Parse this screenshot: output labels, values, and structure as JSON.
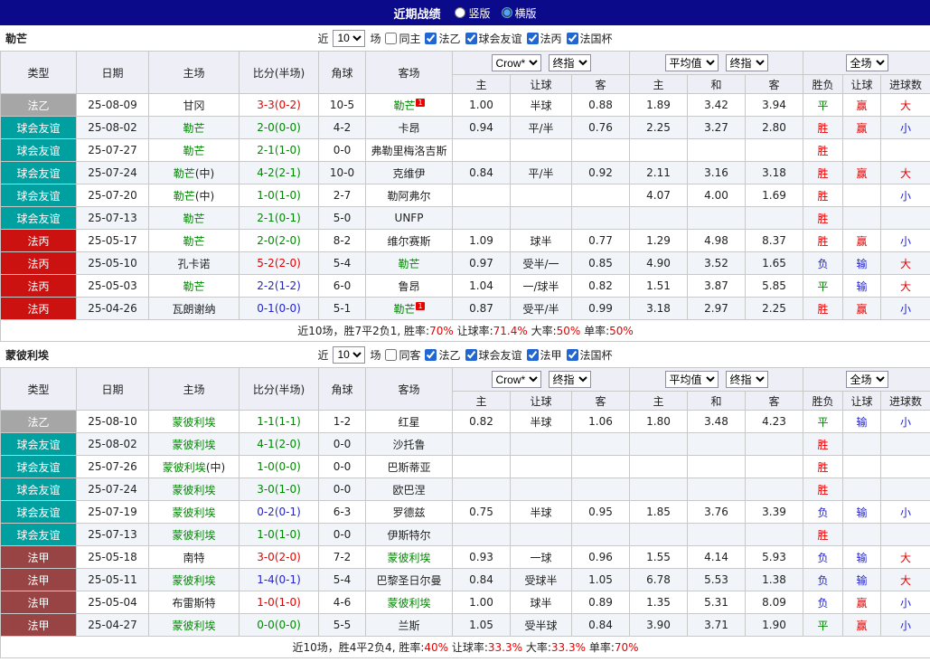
{
  "palette": {
    "black": "#222222",
    "green": "#008800",
    "red": "#e60000",
    "blue": "#2323cc",
    "badge_gray": "#a6a6a6",
    "badge_teal": "#00a0a0",
    "badge_red": "#cc1111",
    "badge_maroon": "#994444",
    "navy": "#0a0a8a"
  },
  "topbar": {
    "title": "近期战绩",
    "options": [
      {
        "label": "竖版",
        "selected": false
      },
      {
        "label": "横版",
        "selected": true
      }
    ]
  },
  "table_header": {
    "cols": [
      "类型",
      "日期",
      "主场",
      "比分(半场)",
      "角球",
      "客场"
    ],
    "group_selects": [
      [
        "Crow*",
        "终指"
      ],
      [
        "平均值",
        "终指"
      ],
      [
        "全场"
      ]
    ],
    "sub": [
      "主",
      "让球",
      "客",
      "主",
      "和",
      "客",
      "胜负",
      "让球",
      "进球数"
    ]
  },
  "sections": [
    {
      "team": "勒芒",
      "filter": {
        "near_label": "近",
        "count": "10",
        "games_label": "场",
        "same_label": "同主",
        "same_checked": false,
        "leagues": [
          "法乙",
          "球会友谊",
          "法丙",
          "法国杯"
        ]
      },
      "rows": [
        {
          "league": "法乙",
          "lc": "badge_gray",
          "date": "25-08-09",
          "home": {
            "t": "甘冈",
            "c": "black"
          },
          "score": {
            "t": "3-3(0-2)",
            "c": "red"
          },
          "corner": "10-5",
          "away": {
            "t": "勒芒",
            "c": "green",
            "sup": "1"
          },
          "odds": [
            "1.00",
            "半球",
            "0.88",
            "1.89",
            "3.42",
            "3.94"
          ],
          "res": [
            [
              "平",
              "green"
            ],
            [
              "赢",
              "red"
            ],
            [
              "大",
              "red"
            ]
          ]
        },
        {
          "league": "球会友谊",
          "lc": "badge_teal",
          "date": "25-08-02",
          "home": {
            "t": "勒芒",
            "c": "green"
          },
          "score": {
            "t": "2-0(0-0)",
            "c": "green"
          },
          "corner": "4-2",
          "away": {
            "t": "卡昂",
            "c": "black"
          },
          "odds": [
            "0.94",
            "平/半",
            "0.76",
            "2.25",
            "3.27",
            "2.80"
          ],
          "res": [
            [
              "胜",
              "red"
            ],
            [
              "赢",
              "red"
            ],
            [
              "小",
              "blue"
            ]
          ]
        },
        {
          "league": "球会友谊",
          "lc": "badge_teal",
          "date": "25-07-27",
          "home": {
            "t": "勒芒",
            "c": "green"
          },
          "score": {
            "t": "2-1(1-0)",
            "c": "green"
          },
          "corner": "0-0",
          "away": {
            "t": "弗勒里梅洛吉斯",
            "c": "black"
          },
          "odds": [
            "",
            "",
            "",
            "",
            "",
            ""
          ],
          "res": [
            [
              "胜",
              "red"
            ],
            [
              "",
              ""
            ],
            [
              "",
              ""
            ]
          ]
        },
        {
          "league": "球会友谊",
          "lc": "badge_teal",
          "date": "25-07-24",
          "home": {
            "t": "勒芒",
            "c": "green",
            "suf": "(中)"
          },
          "score": {
            "t": "4-2(2-1)",
            "c": "green"
          },
          "corner": "10-0",
          "away": {
            "t": "克维伊",
            "c": "black"
          },
          "odds": [
            "0.84",
            "平/半",
            "0.92",
            "2.11",
            "3.16",
            "3.18"
          ],
          "res": [
            [
              "胜",
              "red"
            ],
            [
              "赢",
              "red"
            ],
            [
              "大",
              "red"
            ]
          ]
        },
        {
          "league": "球会友谊",
          "lc": "badge_teal",
          "date": "25-07-20",
          "home": {
            "t": "勒芒",
            "c": "green",
            "suf": "(中)"
          },
          "score": {
            "t": "1-0(1-0)",
            "c": "green"
          },
          "corner": "2-7",
          "away": {
            "t": "勒阿弗尔",
            "c": "black"
          },
          "odds": [
            "",
            "",
            "",
            "4.07",
            "4.00",
            "1.69"
          ],
          "res": [
            [
              "胜",
              "red"
            ],
            [
              "",
              ""
            ],
            [
              "小",
              "blue"
            ]
          ]
        },
        {
          "league": "球会友谊",
          "lc": "badge_teal",
          "date": "25-07-13",
          "home": {
            "t": "勒芒",
            "c": "green"
          },
          "score": {
            "t": "2-1(0-1)",
            "c": "green"
          },
          "corner": "5-0",
          "away": {
            "t": "UNFP",
            "c": "black"
          },
          "odds": [
            "",
            "",
            "",
            "",
            "",
            ""
          ],
          "res": [
            [
              "胜",
              "red"
            ],
            [
              "",
              ""
            ],
            [
              "",
              ""
            ]
          ]
        },
        {
          "league": "法丙",
          "lc": "badge_red",
          "date": "25-05-17",
          "home": {
            "t": "勒芒",
            "c": "green"
          },
          "score": {
            "t": "2-0(2-0)",
            "c": "green"
          },
          "corner": "8-2",
          "away": {
            "t": "维尔赛斯",
            "c": "black"
          },
          "odds": [
            "1.09",
            "球半",
            "0.77",
            "1.29",
            "4.98",
            "8.37"
          ],
          "res": [
            [
              "胜",
              "red"
            ],
            [
              "赢",
              "red"
            ],
            [
              "小",
              "blue"
            ]
          ]
        },
        {
          "league": "法丙",
          "lc": "badge_red",
          "date": "25-05-10",
          "home": {
            "t": "孔卡诺",
            "c": "black"
          },
          "score": {
            "t": "5-2(2-0)",
            "c": "red"
          },
          "corner": "5-4",
          "away": {
            "t": "勒芒",
            "c": "green"
          },
          "odds": [
            "0.97",
            "受半/一",
            "0.85",
            "4.90",
            "3.52",
            "1.65"
          ],
          "res": [
            [
              "负",
              "blue"
            ],
            [
              "输",
              "blue"
            ],
            [
              "大",
              "red"
            ]
          ]
        },
        {
          "league": "法丙",
          "lc": "badge_red",
          "date": "25-05-03",
          "home": {
            "t": "勒芒",
            "c": "green"
          },
          "score": {
            "t": "2-2(1-2)",
            "c": "blue"
          },
          "corner": "6-0",
          "away": {
            "t": "鲁昂",
            "c": "black"
          },
          "odds": [
            "1.04",
            "一/球半",
            "0.82",
            "1.51",
            "3.87",
            "5.85"
          ],
          "res": [
            [
              "平",
              "green"
            ],
            [
              "输",
              "blue"
            ],
            [
              "大",
              "red"
            ]
          ]
        },
        {
          "league": "法丙",
          "lc": "badge_red",
          "date": "25-04-26",
          "home": {
            "t": "瓦朗谢纳",
            "c": "black"
          },
          "score": {
            "t": "0-1(0-0)",
            "c": "blue"
          },
          "corner": "5-1",
          "away": {
            "t": "勒芒",
            "c": "green",
            "sup": "1"
          },
          "odds": [
            "0.87",
            "受平/半",
            "0.99",
            "3.18",
            "2.97",
            "2.25"
          ],
          "res": [
            [
              "胜",
              "red"
            ],
            [
              "赢",
              "red"
            ],
            [
              "小",
              "blue"
            ]
          ]
        }
      ],
      "summary": [
        [
          "近10场，胜7平2负1, 胜率:",
          "black"
        ],
        [
          "70%",
          "red"
        ],
        [
          " 让球率:",
          "black"
        ],
        [
          "71.4%",
          "red"
        ],
        [
          " 大率:",
          "black"
        ],
        [
          "50%",
          "red"
        ],
        [
          " 单率:",
          "black"
        ],
        [
          "50%",
          "red"
        ]
      ]
    },
    {
      "team": "蒙彼利埃",
      "filter": {
        "near_label": "近",
        "count": "10",
        "games_label": "场",
        "same_label": "同客",
        "same_checked": false,
        "leagues": [
          "法乙",
          "球会友谊",
          "法甲",
          "法国杯"
        ]
      },
      "rows": [
        {
          "league": "法乙",
          "lc": "badge_gray",
          "date": "25-08-10",
          "home": {
            "t": "蒙彼利埃",
            "c": "green"
          },
          "score": {
            "t": "1-1(1-1)",
            "c": "green"
          },
          "corner": "1-2",
          "away": {
            "t": "红星",
            "c": "black"
          },
          "odds": [
            "0.82",
            "半球",
            "1.06",
            "1.80",
            "3.48",
            "4.23"
          ],
          "res": [
            [
              "平",
              "green"
            ],
            [
              "输",
              "blue"
            ],
            [
              "小",
              "blue"
            ]
          ]
        },
        {
          "league": "球会友谊",
          "lc": "badge_teal",
          "date": "25-08-02",
          "home": {
            "t": "蒙彼利埃",
            "c": "green"
          },
          "score": {
            "t": "4-1(2-0)",
            "c": "green"
          },
          "corner": "0-0",
          "away": {
            "t": "沙托鲁",
            "c": "black"
          },
          "odds": [
            "",
            "",
            "",
            "",
            "",
            ""
          ],
          "res": [
            [
              "胜",
              "red"
            ],
            [
              "",
              ""
            ],
            [
              "",
              ""
            ]
          ]
        },
        {
          "league": "球会友谊",
          "lc": "badge_teal",
          "date": "25-07-26",
          "home": {
            "t": "蒙彼利埃",
            "c": "green",
            "suf": "(中)"
          },
          "score": {
            "t": "1-0(0-0)",
            "c": "green"
          },
          "corner": "0-0",
          "away": {
            "t": "巴斯蒂亚",
            "c": "black"
          },
          "odds": [
            "",
            "",
            "",
            "",
            "",
            ""
          ],
          "res": [
            [
              "胜",
              "red"
            ],
            [
              "",
              ""
            ],
            [
              "",
              ""
            ]
          ]
        },
        {
          "league": "球会友谊",
          "lc": "badge_teal",
          "date": "25-07-24",
          "home": {
            "t": "蒙彼利埃",
            "c": "green"
          },
          "score": {
            "t": "3-0(1-0)",
            "c": "green"
          },
          "corner": "0-0",
          "away": {
            "t": "欧巴涅",
            "c": "black"
          },
          "odds": [
            "",
            "",
            "",
            "",
            "",
            ""
          ],
          "res": [
            [
              "胜",
              "red"
            ],
            [
              "",
              ""
            ],
            [
              "",
              ""
            ]
          ]
        },
        {
          "league": "球会友谊",
          "lc": "badge_teal",
          "date": "25-07-19",
          "home": {
            "t": "蒙彼利埃",
            "c": "green"
          },
          "score": {
            "t": "0-2(0-1)",
            "c": "blue"
          },
          "corner": "6-3",
          "away": {
            "t": "罗德兹",
            "c": "black"
          },
          "odds": [
            "0.75",
            "半球",
            "0.95",
            "1.85",
            "3.76",
            "3.39"
          ],
          "res": [
            [
              "负",
              "blue"
            ],
            [
              "输",
              "blue"
            ],
            [
              "小",
              "blue"
            ]
          ]
        },
        {
          "league": "球会友谊",
          "lc": "badge_teal",
          "date": "25-07-13",
          "home": {
            "t": "蒙彼利埃",
            "c": "green"
          },
          "score": {
            "t": "1-0(1-0)",
            "c": "green"
          },
          "corner": "0-0",
          "away": {
            "t": "伊斯特尔",
            "c": "black"
          },
          "odds": [
            "",
            "",
            "",
            "",
            "",
            ""
          ],
          "res": [
            [
              "胜",
              "red"
            ],
            [
              "",
              ""
            ],
            [
              "",
              ""
            ]
          ]
        },
        {
          "league": "法甲",
          "lc": "badge_maroon",
          "date": "25-05-18",
          "home": {
            "t": "南特",
            "c": "black"
          },
          "score": {
            "t": "3-0(2-0)",
            "c": "red"
          },
          "corner": "7-2",
          "away": {
            "t": "蒙彼利埃",
            "c": "green"
          },
          "odds": [
            "0.93",
            "一球",
            "0.96",
            "1.55",
            "4.14",
            "5.93"
          ],
          "res": [
            [
              "负",
              "blue"
            ],
            [
              "输",
              "blue"
            ],
            [
              "大",
              "red"
            ]
          ]
        },
        {
          "league": "法甲",
          "lc": "badge_maroon",
          "date": "25-05-11",
          "home": {
            "t": "蒙彼利埃",
            "c": "green"
          },
          "score": {
            "t": "1-4(0-1)",
            "c": "blue"
          },
          "corner": "5-4",
          "away": {
            "t": "巴黎圣日尔曼",
            "c": "black"
          },
          "odds": [
            "0.84",
            "受球半",
            "1.05",
            "6.78",
            "5.53",
            "1.38"
          ],
          "res": [
            [
              "负",
              "blue"
            ],
            [
              "输",
              "blue"
            ],
            [
              "大",
              "red"
            ]
          ]
        },
        {
          "league": "法甲",
          "lc": "badge_maroon",
          "date": "25-05-04",
          "home": {
            "t": "布雷斯特",
            "c": "black"
          },
          "score": {
            "t": "1-0(1-0)",
            "c": "red"
          },
          "corner": "4-6",
          "away": {
            "t": "蒙彼利埃",
            "c": "green"
          },
          "odds": [
            "1.00",
            "球半",
            "0.89",
            "1.35",
            "5.31",
            "8.09"
          ],
          "res": [
            [
              "负",
              "blue"
            ],
            [
              "赢",
              "red"
            ],
            [
              "小",
              "blue"
            ]
          ]
        },
        {
          "league": "法甲",
          "lc": "badge_maroon",
          "date": "25-04-27",
          "home": {
            "t": "蒙彼利埃",
            "c": "green"
          },
          "score": {
            "t": "0-0(0-0)",
            "c": "green"
          },
          "corner": "5-5",
          "away": {
            "t": "兰斯",
            "c": "black"
          },
          "odds": [
            "1.05",
            "受半球",
            "0.84",
            "3.90",
            "3.71",
            "1.90"
          ],
          "res": [
            [
              "平",
              "green"
            ],
            [
              "赢",
              "red"
            ],
            [
              "小",
              "blue"
            ]
          ]
        }
      ],
      "summary": [
        [
          "近10场，胜4平2负4, 胜率:",
          "black"
        ],
        [
          "40%",
          "red"
        ],
        [
          " 让球率:",
          "black"
        ],
        [
          "33.3%",
          "red"
        ],
        [
          " 大率:",
          "black"
        ],
        [
          "33.3%",
          "red"
        ],
        [
          " 单率:",
          "black"
        ],
        [
          "70%",
          "red"
        ]
      ]
    }
  ]
}
